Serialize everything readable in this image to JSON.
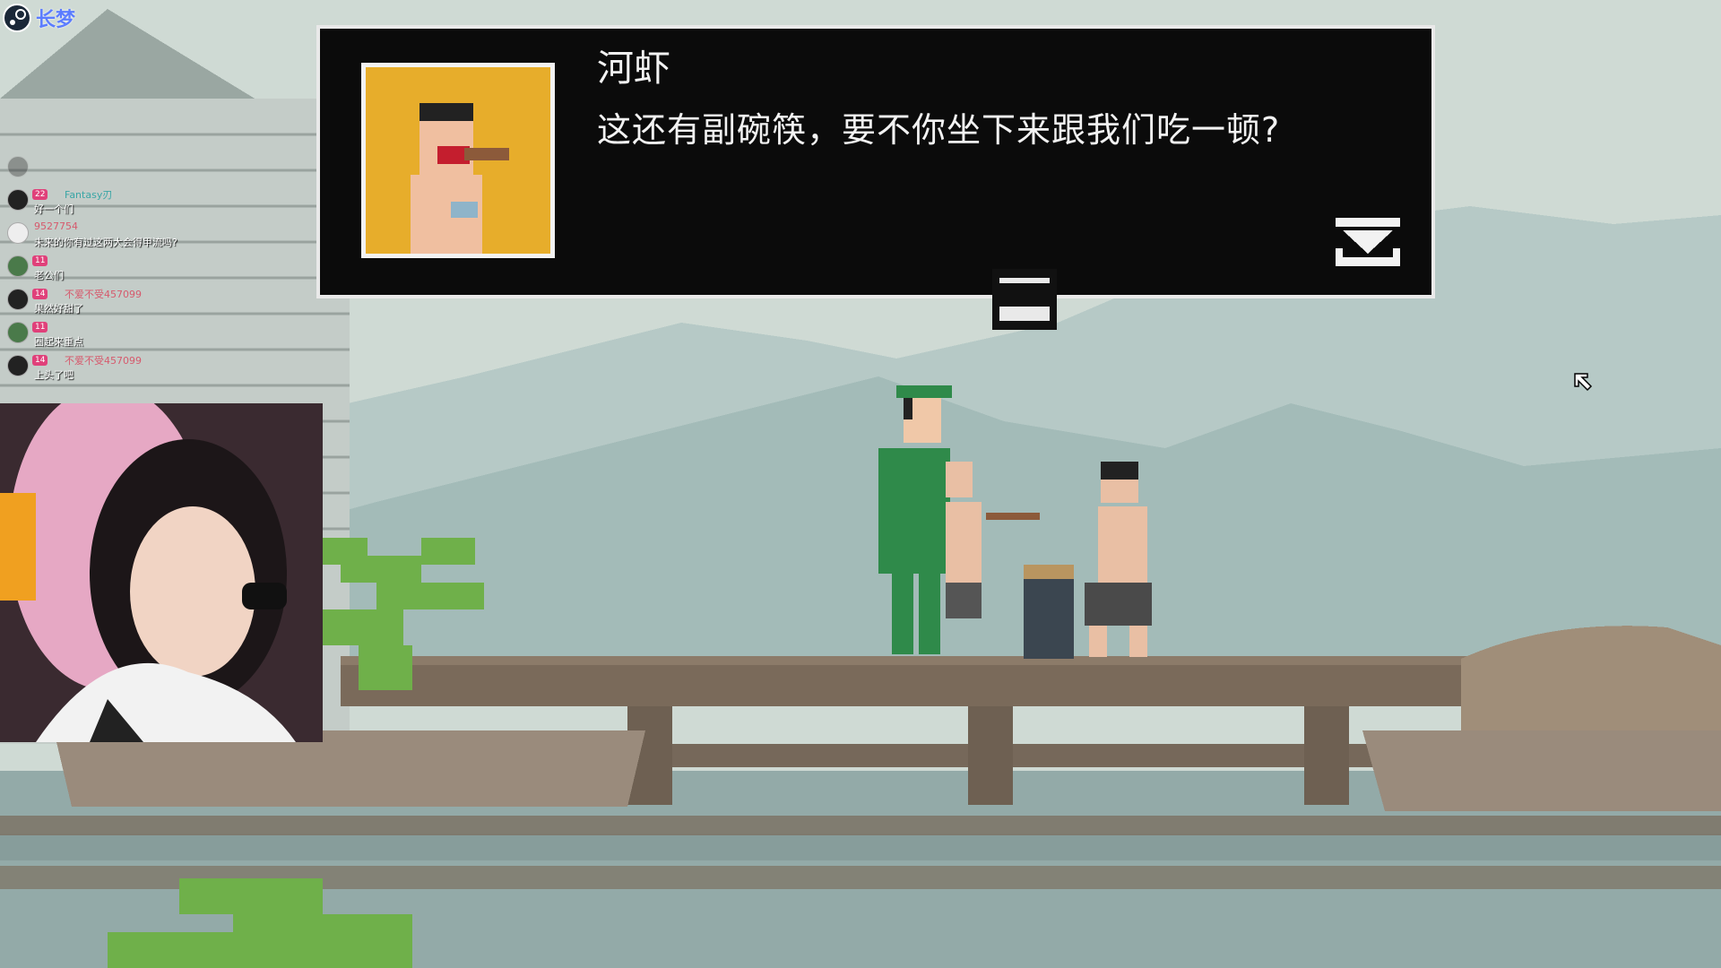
{
  "overlay": {
    "steam_label": "长梦",
    "chat": [
      {
        "level": "",
        "user": "",
        "text": "",
        "faded": true
      },
      {
        "level": "22",
        "user": "Fantasy刃",
        "text": "好一个们"
      },
      {
        "level": "",
        "user": "9527754",
        "text": "未来的你有过这两大会得甲流吗?"
      },
      {
        "level": "11",
        "user": "",
        "text": "老公们"
      },
      {
        "level": "14",
        "user": "不爱不受457099",
        "text": "果然好甜了"
      },
      {
        "level": "11",
        "user": "",
        "text": "圈起来重点"
      },
      {
        "level": "14",
        "user": "不爱不受457099",
        "text": "上头了吧"
      }
    ]
  },
  "dialog": {
    "speaker": "河虾",
    "line": "这还有副碗筷，要不你坐下来跟我们吃一顿?"
  },
  "colors": {
    "sky": "#cdd8d2",
    "mountain": "#9fb6b4",
    "bridge": "#7b6a5a",
    "water": "#8fa7a6",
    "portrait_bg": "#e7ad2b",
    "uniform": "#2f8a4a"
  }
}
